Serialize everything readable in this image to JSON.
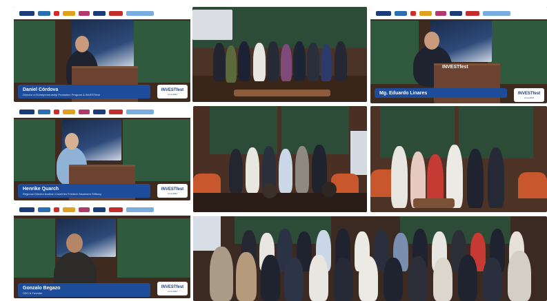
{
  "speakers": [
    {
      "name": "Daniel Córdova",
      "role": "Director of Entrepreneurship Promotion Program & INVESTfest"
    },
    {
      "name": "Mg. Eduardo Linares",
      "role": ""
    },
    {
      "name": "Henrike Quarch",
      "role": "Regional Director Andean Countries Friedrich Naumann Stiftung"
    },
    {
      "name": "Gonzalo Begazo",
      "role": "CEO & Founder"
    }
  ],
  "event_badge": {
    "title": "INVESTfest",
    "subtitle": "Lima 2024"
  },
  "screen_text": "INVESTfest",
  "colors": {
    "banner": "#1d4c9b",
    "board": "#2f5a3e",
    "wood": "#5a3624"
  }
}
